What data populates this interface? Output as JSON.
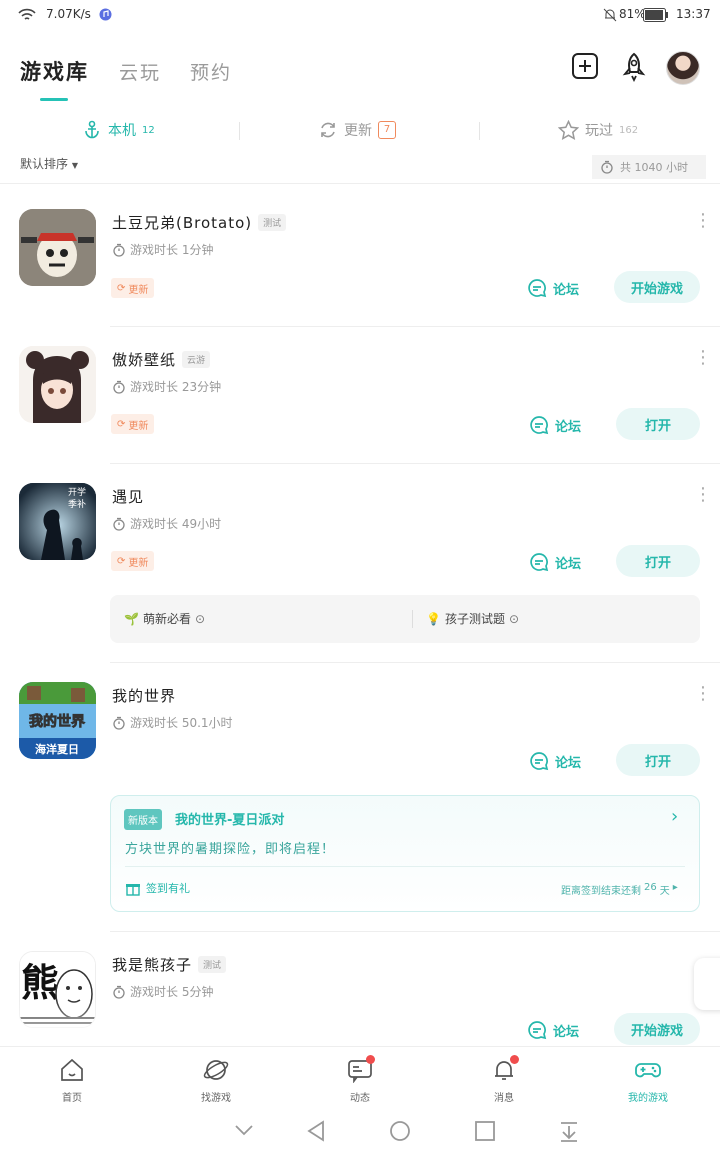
{
  "status_bar": {
    "net_speed": "7.07K/s",
    "battery": "81%",
    "time": "13:37"
  },
  "top_tabs": [
    {
      "label": "游戏库",
      "active": true
    },
    {
      "label": "云玩",
      "active": false
    },
    {
      "label": "预约",
      "active": false
    }
  ],
  "sub_tabs": {
    "local": {
      "label": "本机",
      "count": "12"
    },
    "update": {
      "label": "更新",
      "count": "7"
    },
    "played": {
      "label": "玩过",
      "count": "162"
    }
  },
  "sort_label": "默认排序",
  "total_time": "共 1040 小时",
  "games": [
    {
      "name": "土豆兄弟(Brotato)",
      "tag": "测试",
      "playtime": "游戏时长 1分钟",
      "update": "更新",
      "forum": "论坛",
      "action": "开始游戏"
    },
    {
      "name": "傲娇壁纸",
      "tag": "云游",
      "playtime": "游戏时长 23分钟",
      "update": "更新",
      "forum": "论坛",
      "action": "打开"
    },
    {
      "name": "遇见",
      "tag": "",
      "playtime": "游戏时长 49小时",
      "update": "更新",
      "forum": "论坛",
      "action": "打开"
    },
    {
      "name": "我的世界",
      "tag": "",
      "playtime": "游戏时长 50.1小时",
      "update": "",
      "forum": "论坛",
      "action": "打开"
    },
    {
      "name": "我是熊孩子",
      "tag": "测试",
      "playtime": "游戏时长 5分钟",
      "update": "",
      "forum": "论坛",
      "action": "开始游戏"
    }
  ],
  "chips": {
    "chip1": "萌新必看",
    "chip2": "孩子测试题"
  },
  "icon_text": {
    "g3_top": "开学",
    "g3_bottom": "季补",
    "g4_logo": "我的世界",
    "g4_banner": "海洋夏日",
    "g5_char": "熊"
  },
  "promo": {
    "badge": "新版本",
    "title": "我的世界-夏日派对",
    "desc": "方块世界的暑期探险，即将启程！",
    "gift": "签到有礼",
    "countdown_prefix": "距离签到结束还剩",
    "countdown_days": "26",
    "countdown_unit": "天"
  },
  "bottom_nav": [
    {
      "label": "首页",
      "active": false
    },
    {
      "label": "找游戏",
      "active": false
    },
    {
      "label": "动态",
      "active": false
    },
    {
      "label": "消息",
      "active": false
    },
    {
      "label": "我的游戏",
      "active": true
    }
  ],
  "colors": {
    "accent": "#25b7ab",
    "update": "#f08a5d",
    "badge_dot": "#f04d4d"
  }
}
